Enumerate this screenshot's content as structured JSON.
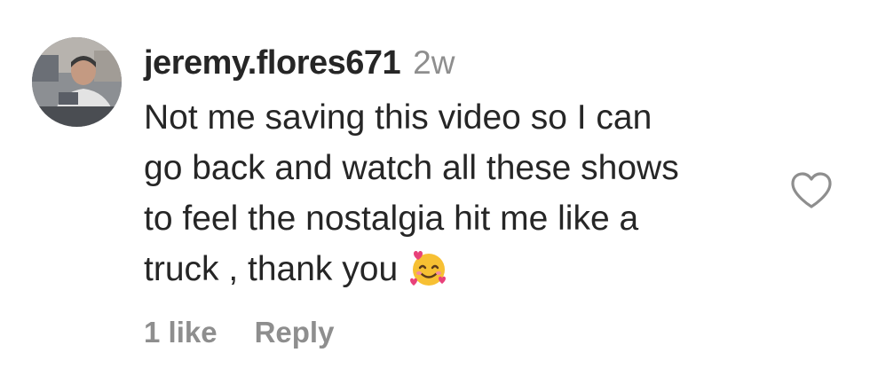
{
  "comment": {
    "username": "jeremy.flores671",
    "time": "2w",
    "text_lines": [
      "Not me saving this video so I can",
      "go back and watch all these shows",
      "to feel the nostalgia hit me like a",
      "truck , thank you"
    ],
    "emoji_icon": "smiling-face-with-hearts-icon",
    "like_count": "1 like",
    "reply_label": "Reply",
    "like_icon": "heart-outline-icon"
  },
  "colors": {
    "primary_text": "#262626",
    "secondary_text": "#8e8e8e"
  }
}
